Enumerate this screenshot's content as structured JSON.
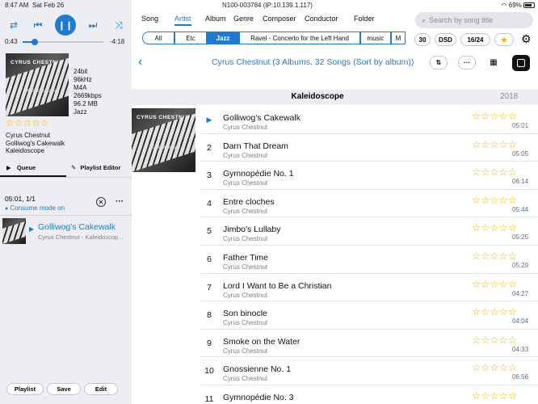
{
  "status": {
    "time": "8:47 AM",
    "date": "Sat Feb 26",
    "device": "N100-003784 (IP:10.139.1.117)",
    "battery": "69%"
  },
  "player": {
    "elapsed": "0:43",
    "remaining": "-4:18",
    "progress_fraction": 0.15,
    "artist": "Cyrus Chestnut",
    "track": "Golliwog's Cakewalk",
    "album": "Kaleidoscope",
    "rating_stars": 0,
    "format": {
      "bits": "24bit",
      "rate": "96kHz",
      "codec": "M4A",
      "bitrate": "2669kbps",
      "size": "96.2 MB",
      "genre": "Jazz"
    }
  },
  "album_art": {
    "artist_text": "CYRUS CHESTNUT",
    "title_text": "Kaleidoscope"
  },
  "left_tabs": {
    "queue": "Queue",
    "playlist_editor": "Playlist Editor"
  },
  "queue": {
    "summary": "05:01, 1/1",
    "consume": "Consume mode on",
    "item": {
      "title": "Golliwog's Cakewalk",
      "subtitle": "Cyrus Chestnut - Kaleidoscop..."
    }
  },
  "bottom_buttons": {
    "playlist": "Playlist",
    "save": "Save",
    "edit": "Edit"
  },
  "nav_tabs": [
    "Song",
    "Artist",
    "Album",
    "Genre",
    "Composer",
    "Conductor",
    "Folder"
  ],
  "active_nav": "Artist",
  "filter_chips": [
    "All",
    "Etc",
    "Jazz",
    "Ravel - Concerto for the Left Hand",
    "music",
    "M"
  ],
  "active_chip": "Jazz",
  "search": {
    "placeholder": "Search by song title"
  },
  "quick_buttons": {
    "b1": "30",
    "b2": "DSD",
    "b3": "16/24"
  },
  "header_title": "Cyrus Chestnut (3 Albums, 32 Songs (Sort by album))",
  "album_section": {
    "name": "Kaleidoscope",
    "year": "2018"
  },
  "tracks": [
    {
      "num": "",
      "title": "Golliwog's Cakewalk",
      "artist": "Cyrus Chestnut",
      "duration": "05:01",
      "playing": true
    },
    {
      "num": "2",
      "title": "Darn That Dream",
      "artist": "Cyrus Chestnut",
      "duration": "05:05"
    },
    {
      "num": "3",
      "title": "Gymnopédie No. 1",
      "artist": "Cyrus Chestnut",
      "duration": "06:14"
    },
    {
      "num": "4",
      "title": "Entre cloches",
      "artist": "Cyrus Chestnut",
      "duration": "05:44"
    },
    {
      "num": "5",
      "title": "Jimbo's Lullaby",
      "artist": "Cyrus Chestnut",
      "duration": "05:25"
    },
    {
      "num": "6",
      "title": "Father Time",
      "artist": "Cyrus Chestnut",
      "duration": "05:29"
    },
    {
      "num": "7",
      "title": "Lord I Want to Be a Christian",
      "artist": "Cyrus Chestnut",
      "duration": "04:27"
    },
    {
      "num": "8",
      "title": "Son binocle",
      "artist": "Cyrus Chestnut",
      "duration": "04:04"
    },
    {
      "num": "9",
      "title": "Smoke on the Water",
      "artist": "Cyrus Chestnut",
      "duration": "04:33"
    },
    {
      "num": "10",
      "title": "Gnossienne No. 1",
      "artist": "Cyrus Chestnut",
      "duration": "06:56"
    },
    {
      "num": "11",
      "title": "Gymnopédie No. 3",
      "artist": "",
      "duration": ""
    }
  ],
  "colors": {
    "accent": "#1f7bd1",
    "star": "#f3b400",
    "panel": "#eceef3"
  }
}
